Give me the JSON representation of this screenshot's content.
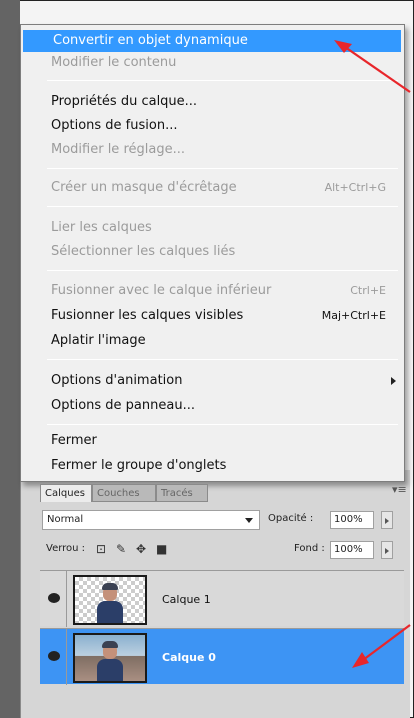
{
  "menu": {
    "items": [
      {
        "label": "Convertir en objet dynamique",
        "state": "highlighted"
      },
      {
        "label": "Modifier le contenu",
        "state": "disabled"
      },
      {
        "label": "Propriétés du calque...",
        "state": "enabled"
      },
      {
        "label": "Options de fusion...",
        "state": "enabled"
      },
      {
        "label": "Modifier le réglage...",
        "state": "disabled"
      },
      {
        "label": "Créer un masque d'écrêtage",
        "shortcut": "Alt+Ctrl+G",
        "state": "disabled"
      },
      {
        "label": "Lier les calques",
        "state": "disabled"
      },
      {
        "label": "Sélectionner les calques liés",
        "state": "disabled"
      },
      {
        "label": "Fusionner avec le calque inférieur",
        "shortcut": "Ctrl+E",
        "state": "disabled"
      },
      {
        "label": "Fusionner les calques visibles",
        "shortcut": "Maj+Ctrl+E",
        "state": "enabled"
      },
      {
        "label": "Aplatir l'image",
        "state": "enabled"
      },
      {
        "label": "Options d'animation",
        "state": "enabled",
        "submenu": true
      },
      {
        "label": "Options de panneau...",
        "state": "enabled"
      },
      {
        "label": "Fermer",
        "state": "enabled"
      },
      {
        "label": "Fermer le groupe d'onglets",
        "state": "enabled"
      }
    ]
  },
  "layers_panel": {
    "tabs": [
      "Calques",
      "Couches",
      "Tracés"
    ],
    "active_tab": "Calques",
    "blend_mode": "Normal",
    "opacity_label": "Opacité :",
    "opacity_value": "100%",
    "lock_label": "Verrou :",
    "fill_label": "Fond :",
    "fill_value": "100%",
    "layers": [
      {
        "name": "Calque 1",
        "selected": false
      },
      {
        "name": "Calque 0",
        "selected": true
      }
    ]
  },
  "colors": {
    "highlight": "#3399ff",
    "selected_layer": "#3d94f4",
    "annotation_arrow": "#e8262b"
  },
  "icons": [
    "eye-icon",
    "lock-transparent-icon",
    "lock-paint-icon",
    "lock-move-icon",
    "lock-all-icon",
    "submenu-arrow-icon",
    "dropdown-arrow-icon",
    "panel-menu-icon"
  ]
}
